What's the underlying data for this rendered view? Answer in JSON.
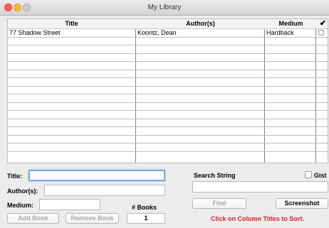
{
  "window": {
    "title": "My Library"
  },
  "table": {
    "columns": {
      "title": "Title",
      "author": "Author(s)",
      "medium": "Medium",
      "check": "✔"
    },
    "rows": [
      {
        "title": "77 Shadow Street",
        "author": "Koontz, Dean",
        "medium": "Hardback"
      }
    ],
    "empty_rows": 14
  },
  "form": {
    "title_label": "Title:",
    "title_value": "",
    "author_label": "Author(s):",
    "author_value": "",
    "medium_label": "Medium:",
    "medium_value": "",
    "add_button": "Add Book",
    "remove_button": "Remove Book",
    "count_label": "# Books",
    "count_value": "1"
  },
  "search": {
    "label": "Search String",
    "gist_label": "Gist",
    "value": "",
    "find_button": "Find",
    "screenshot_button": "Screenshot",
    "hint": "Click on Column Titles to Sort."
  },
  "colors": {
    "hint": "#e02020",
    "focus": "#7ba7e1"
  }
}
